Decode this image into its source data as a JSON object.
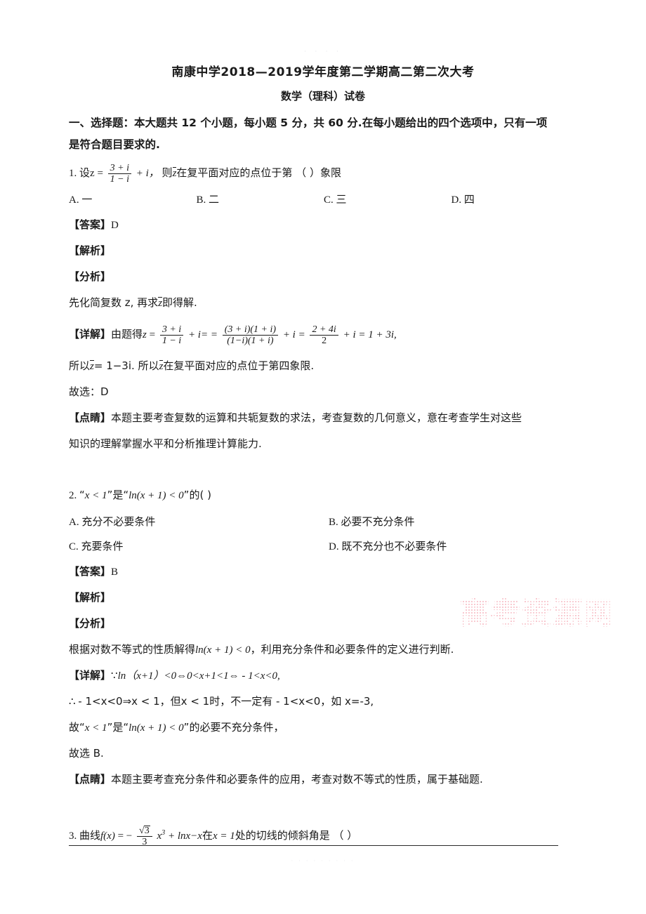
{
  "document": {
    "title": "南康中学2018—2019学年度第二学期高二第二次大考",
    "subtitle": "数学（理科）试卷",
    "watermark_text": "高考资源网",
    "watermark_color": "#f4a0aa",
    "dots_marker": "· · · ·",
    "footer_dots": "· · · · · · · · ·"
  },
  "section": {
    "heading_line1": "一、选择题：本大题共 12 个小题，每小题 5 分，共 60 分.在每小题给出的四个选项中，只有一项",
    "heading_line2": "是符合题目要求的."
  },
  "questions": [
    {
      "number": "1.",
      "stem_prefix": "设",
      "stem_var": "z",
      "stem_eq": "=",
      "frac_num": "3 + i",
      "frac_den": "1 − i",
      "stem_plus": "+ i，",
      "stem_mid": "则",
      "stem_conj": "z",
      "stem_tail": "在复平面对应的点位于第 （      ）象限",
      "options": [
        {
          "label": "A.",
          "text": "一"
        },
        {
          "label": "B.",
          "text": "二"
        },
        {
          "label": "C.",
          "text": "三"
        },
        {
          "label": "D.",
          "text": "四"
        }
      ],
      "answer_label": "【答案】",
      "answer_value": "D",
      "jiexi_label": "【解析】",
      "fenxi_label": "【分析】",
      "fenxi_text_a": "先化简复数 z, 再求",
      "fenxi_conj": "z",
      "fenxi_text_b": "即得解.",
      "xiangjie_label": "【详解】",
      "xiangjie_lead": "由题得",
      "xiangjie_z": "z",
      "xiangjie_eq1": "=",
      "f1_num": "3 + i",
      "f1_den": "1 − i",
      "xiangjie_op1": "+ i= =",
      "f2_num": "(3 + i)(1 + i)",
      "f2_den": "(1−i)(1 + i)",
      "xiangjie_op2": "+ i =",
      "f3_num": "2 + 4i",
      "f3_den": "2",
      "xiangjie_op3": "+ i = 1 + 3i,",
      "concl_a": "所以",
      "concl_conj1": "z",
      "concl_b": "= 1−3i. 所以",
      "concl_conj2": "z",
      "concl_c": "在复平面对应的点位于第四象限.",
      "choose_text": "故选：D",
      "dianjing_label": "【点睛】",
      "dianjing_line1": "本题主要考查复数的运算和共轭复数的求法，考查复数的几何意义，意在考查学生对这些",
      "dianjing_line2": "知识的理解掌握水平和分析推理计算能力."
    },
    {
      "number": "2.",
      "stem_q1": "“",
      "stem_x1": "x < 1",
      "stem_q2": "”是“",
      "stem_x2": "ln(x + 1) < 0",
      "stem_q3": "”的(      )",
      "options": [
        {
          "label": "A.",
          "text": "充分不必要条件"
        },
        {
          "label": "B.",
          "text": "必要不充分条件"
        },
        {
          "label": "C.",
          "text": "充要条件"
        },
        {
          "label": "D.",
          "text": "既不充分也不必要条件"
        }
      ],
      "answer_label": "【答案】",
      "answer_value": "B",
      "jiexi_label": "【解析】",
      "fenxi_label": "【分析】",
      "fenxi_a": "根据对数不等式的性质解得",
      "fenxi_math": "ln(x + 1) < 0",
      "fenxi_b": "，利用充分条件和必要条件的定义进行判断.",
      "xiangjie_label": "【详解】",
      "xj_sym": "∵",
      "xj_line1": "ln（x+1）<0⇔0<x+1<1⇔ - 1<x<0,",
      "xj_line2_sym": "∴",
      "xj_line2": "- 1<x<0⇒x < 1，但x < 1时，不一定有 - 1<x<0，如 x=-3,",
      "xj_line3_a": "故“",
      "xj_line3_m1": "x < 1",
      "xj_line3_b": "”是“",
      "xj_line3_m2": "ln(x + 1) < 0",
      "xj_line3_c": "”的必要不充分条件，",
      "choose_text": "故选 B.",
      "dianjing_label": "【点睛】",
      "dianjing_line1": "本题主要考查充分条件和必要条件的应用，考查对数不等式的性质，属于基础题."
    },
    {
      "number": "3.",
      "stem_a": "曲线",
      "stem_f": "f(x)",
      "stem_eq": "= −",
      "sqrt_num": "3",
      "sqrt_den": "3",
      "stem_x3": "x",
      "stem_x3_sup": "3",
      "stem_b": "+ lnx−x",
      "stem_cjk": "在",
      "stem_c": "x = 1",
      "stem_d": "处的切线的倾斜角是 （  ）"
    }
  ]
}
